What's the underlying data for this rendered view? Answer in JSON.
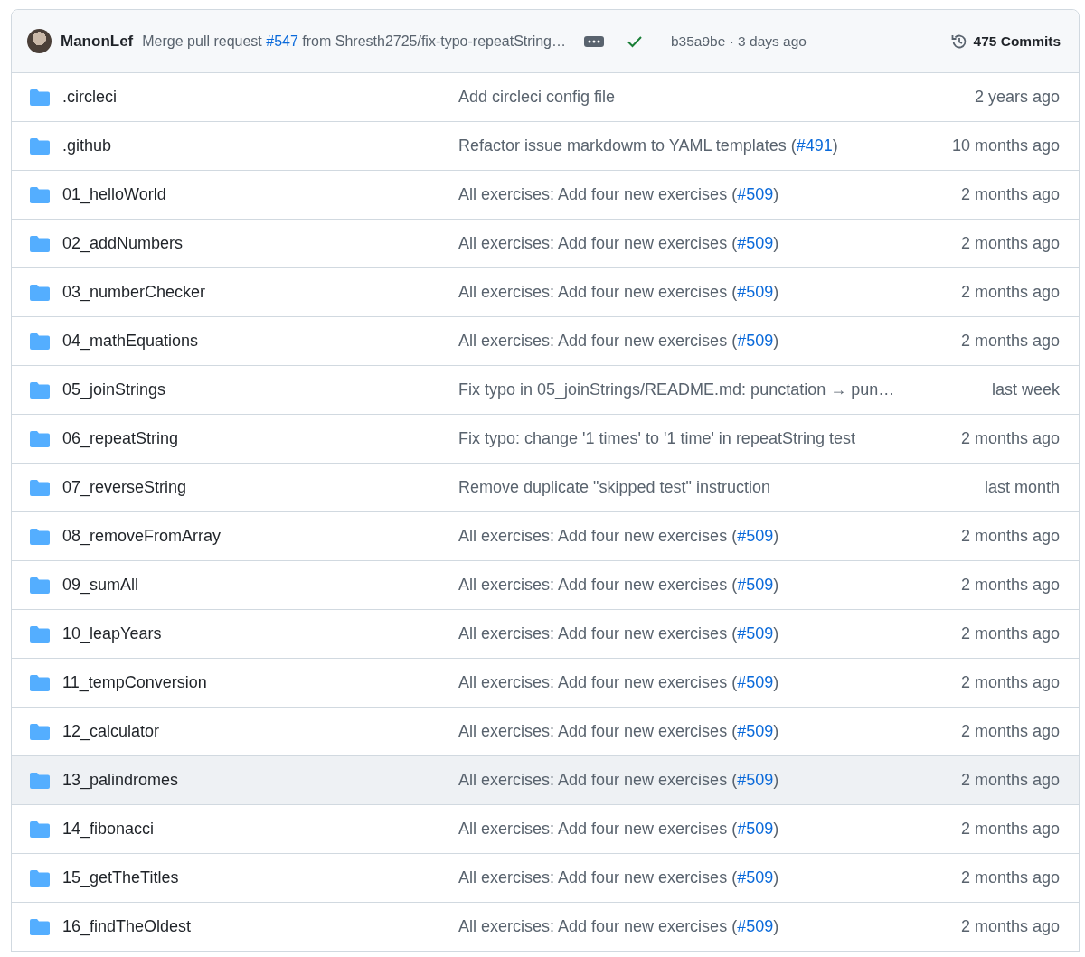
{
  "latest_commit": {
    "author": "ManonLef",
    "message": [
      {
        "kind": "text",
        "text": "Merge pull request "
      },
      {
        "kind": "link",
        "text": "#547"
      },
      {
        "kind": "text",
        "text": " from Shresth2725/fix-typo-repeatString…"
      }
    ],
    "checks_passed": true,
    "sha": "b35a9be",
    "separator": "·",
    "time": "3 days ago",
    "commits": "475 Commits"
  },
  "files": [
    {
      "name": ".circleci",
      "message": [
        {
          "kind": "text",
          "text": "Add circleci config file"
        }
      ],
      "time": "2 years ago",
      "selected": false
    },
    {
      "name": ".github",
      "message": [
        {
          "kind": "text",
          "text": "Refactor issue markdowm to YAML templates ("
        },
        {
          "kind": "link",
          "text": "#491"
        },
        {
          "kind": "text",
          "text": ")"
        }
      ],
      "time": "10 months ago",
      "selected": false
    },
    {
      "name": "01_helloWorld",
      "message": [
        {
          "kind": "text",
          "text": "All exercises: Add four new exercises ("
        },
        {
          "kind": "link",
          "text": "#509"
        },
        {
          "kind": "text",
          "text": ")"
        }
      ],
      "time": "2 months ago",
      "selected": false
    },
    {
      "name": "02_addNumbers",
      "message": [
        {
          "kind": "text",
          "text": "All exercises: Add four new exercises ("
        },
        {
          "kind": "link",
          "text": "#509"
        },
        {
          "kind": "text",
          "text": ")"
        }
      ],
      "time": "2 months ago",
      "selected": false
    },
    {
      "name": "03_numberChecker",
      "message": [
        {
          "kind": "text",
          "text": "All exercises: Add four new exercises ("
        },
        {
          "kind": "link",
          "text": "#509"
        },
        {
          "kind": "text",
          "text": ")"
        }
      ],
      "time": "2 months ago",
      "selected": false
    },
    {
      "name": "04_mathEquations",
      "message": [
        {
          "kind": "text",
          "text": "All exercises: Add four new exercises ("
        },
        {
          "kind": "link",
          "text": "#509"
        },
        {
          "kind": "text",
          "text": ")"
        }
      ],
      "time": "2 months ago",
      "selected": false
    },
    {
      "name": "05_joinStrings",
      "message": [
        {
          "kind": "text",
          "text": "Fix typo in 05_joinStrings/README.md: punctation → pun…"
        }
      ],
      "time": "last week",
      "selected": false
    },
    {
      "name": "06_repeatString",
      "message": [
        {
          "kind": "text",
          "text": "Fix typo: change '1 times' to '1 time' in repeatString test"
        }
      ],
      "time": "2 months ago",
      "selected": false
    },
    {
      "name": "07_reverseString",
      "message": [
        {
          "kind": "text",
          "text": "Remove duplicate \"skipped test\" instruction"
        }
      ],
      "time": "last month",
      "selected": false
    },
    {
      "name": "08_removeFromArray",
      "message": [
        {
          "kind": "text",
          "text": "All exercises: Add four new exercises ("
        },
        {
          "kind": "link",
          "text": "#509"
        },
        {
          "kind": "text",
          "text": ")"
        }
      ],
      "time": "2 months ago",
      "selected": false
    },
    {
      "name": "09_sumAll",
      "message": [
        {
          "kind": "text",
          "text": "All exercises: Add four new exercises ("
        },
        {
          "kind": "link",
          "text": "#509"
        },
        {
          "kind": "text",
          "text": ")"
        }
      ],
      "time": "2 months ago",
      "selected": false
    },
    {
      "name": "10_leapYears",
      "message": [
        {
          "kind": "text",
          "text": "All exercises: Add four new exercises ("
        },
        {
          "kind": "link",
          "text": "#509"
        },
        {
          "kind": "text",
          "text": ")"
        }
      ],
      "time": "2 months ago",
      "selected": false
    },
    {
      "name": "11_tempConversion",
      "message": [
        {
          "kind": "text",
          "text": "All exercises: Add four new exercises ("
        },
        {
          "kind": "link",
          "text": "#509"
        },
        {
          "kind": "text",
          "text": ")"
        }
      ],
      "time": "2 months ago",
      "selected": false
    },
    {
      "name": "12_calculator",
      "message": [
        {
          "kind": "text",
          "text": "All exercises: Add four new exercises ("
        },
        {
          "kind": "link",
          "text": "#509"
        },
        {
          "kind": "text",
          "text": ")"
        }
      ],
      "time": "2 months ago",
      "selected": false
    },
    {
      "name": "13_palindromes",
      "message": [
        {
          "kind": "text",
          "text": "All exercises: Add four new exercises ("
        },
        {
          "kind": "link",
          "text": "#509"
        },
        {
          "kind": "text",
          "text": ")"
        }
      ],
      "time": "2 months ago",
      "selected": true
    },
    {
      "name": "14_fibonacci",
      "message": [
        {
          "kind": "text",
          "text": "All exercises: Add four new exercises ("
        },
        {
          "kind": "link",
          "text": "#509"
        },
        {
          "kind": "text",
          "text": ")"
        }
      ],
      "time": "2 months ago",
      "selected": false
    },
    {
      "name": "15_getTheTitles",
      "message": [
        {
          "kind": "text",
          "text": "All exercises: Add four new exercises ("
        },
        {
          "kind": "link",
          "text": "#509"
        },
        {
          "kind": "text",
          "text": ")"
        }
      ],
      "time": "2 months ago",
      "selected": false
    },
    {
      "name": "16_findTheOldest",
      "message": [
        {
          "kind": "text",
          "text": "All exercises: Add four new exercises ("
        },
        {
          "kind": "link",
          "text": "#509"
        },
        {
          "kind": "text",
          "text": ")"
        }
      ],
      "time": "2 months ago",
      "selected": false
    }
  ]
}
